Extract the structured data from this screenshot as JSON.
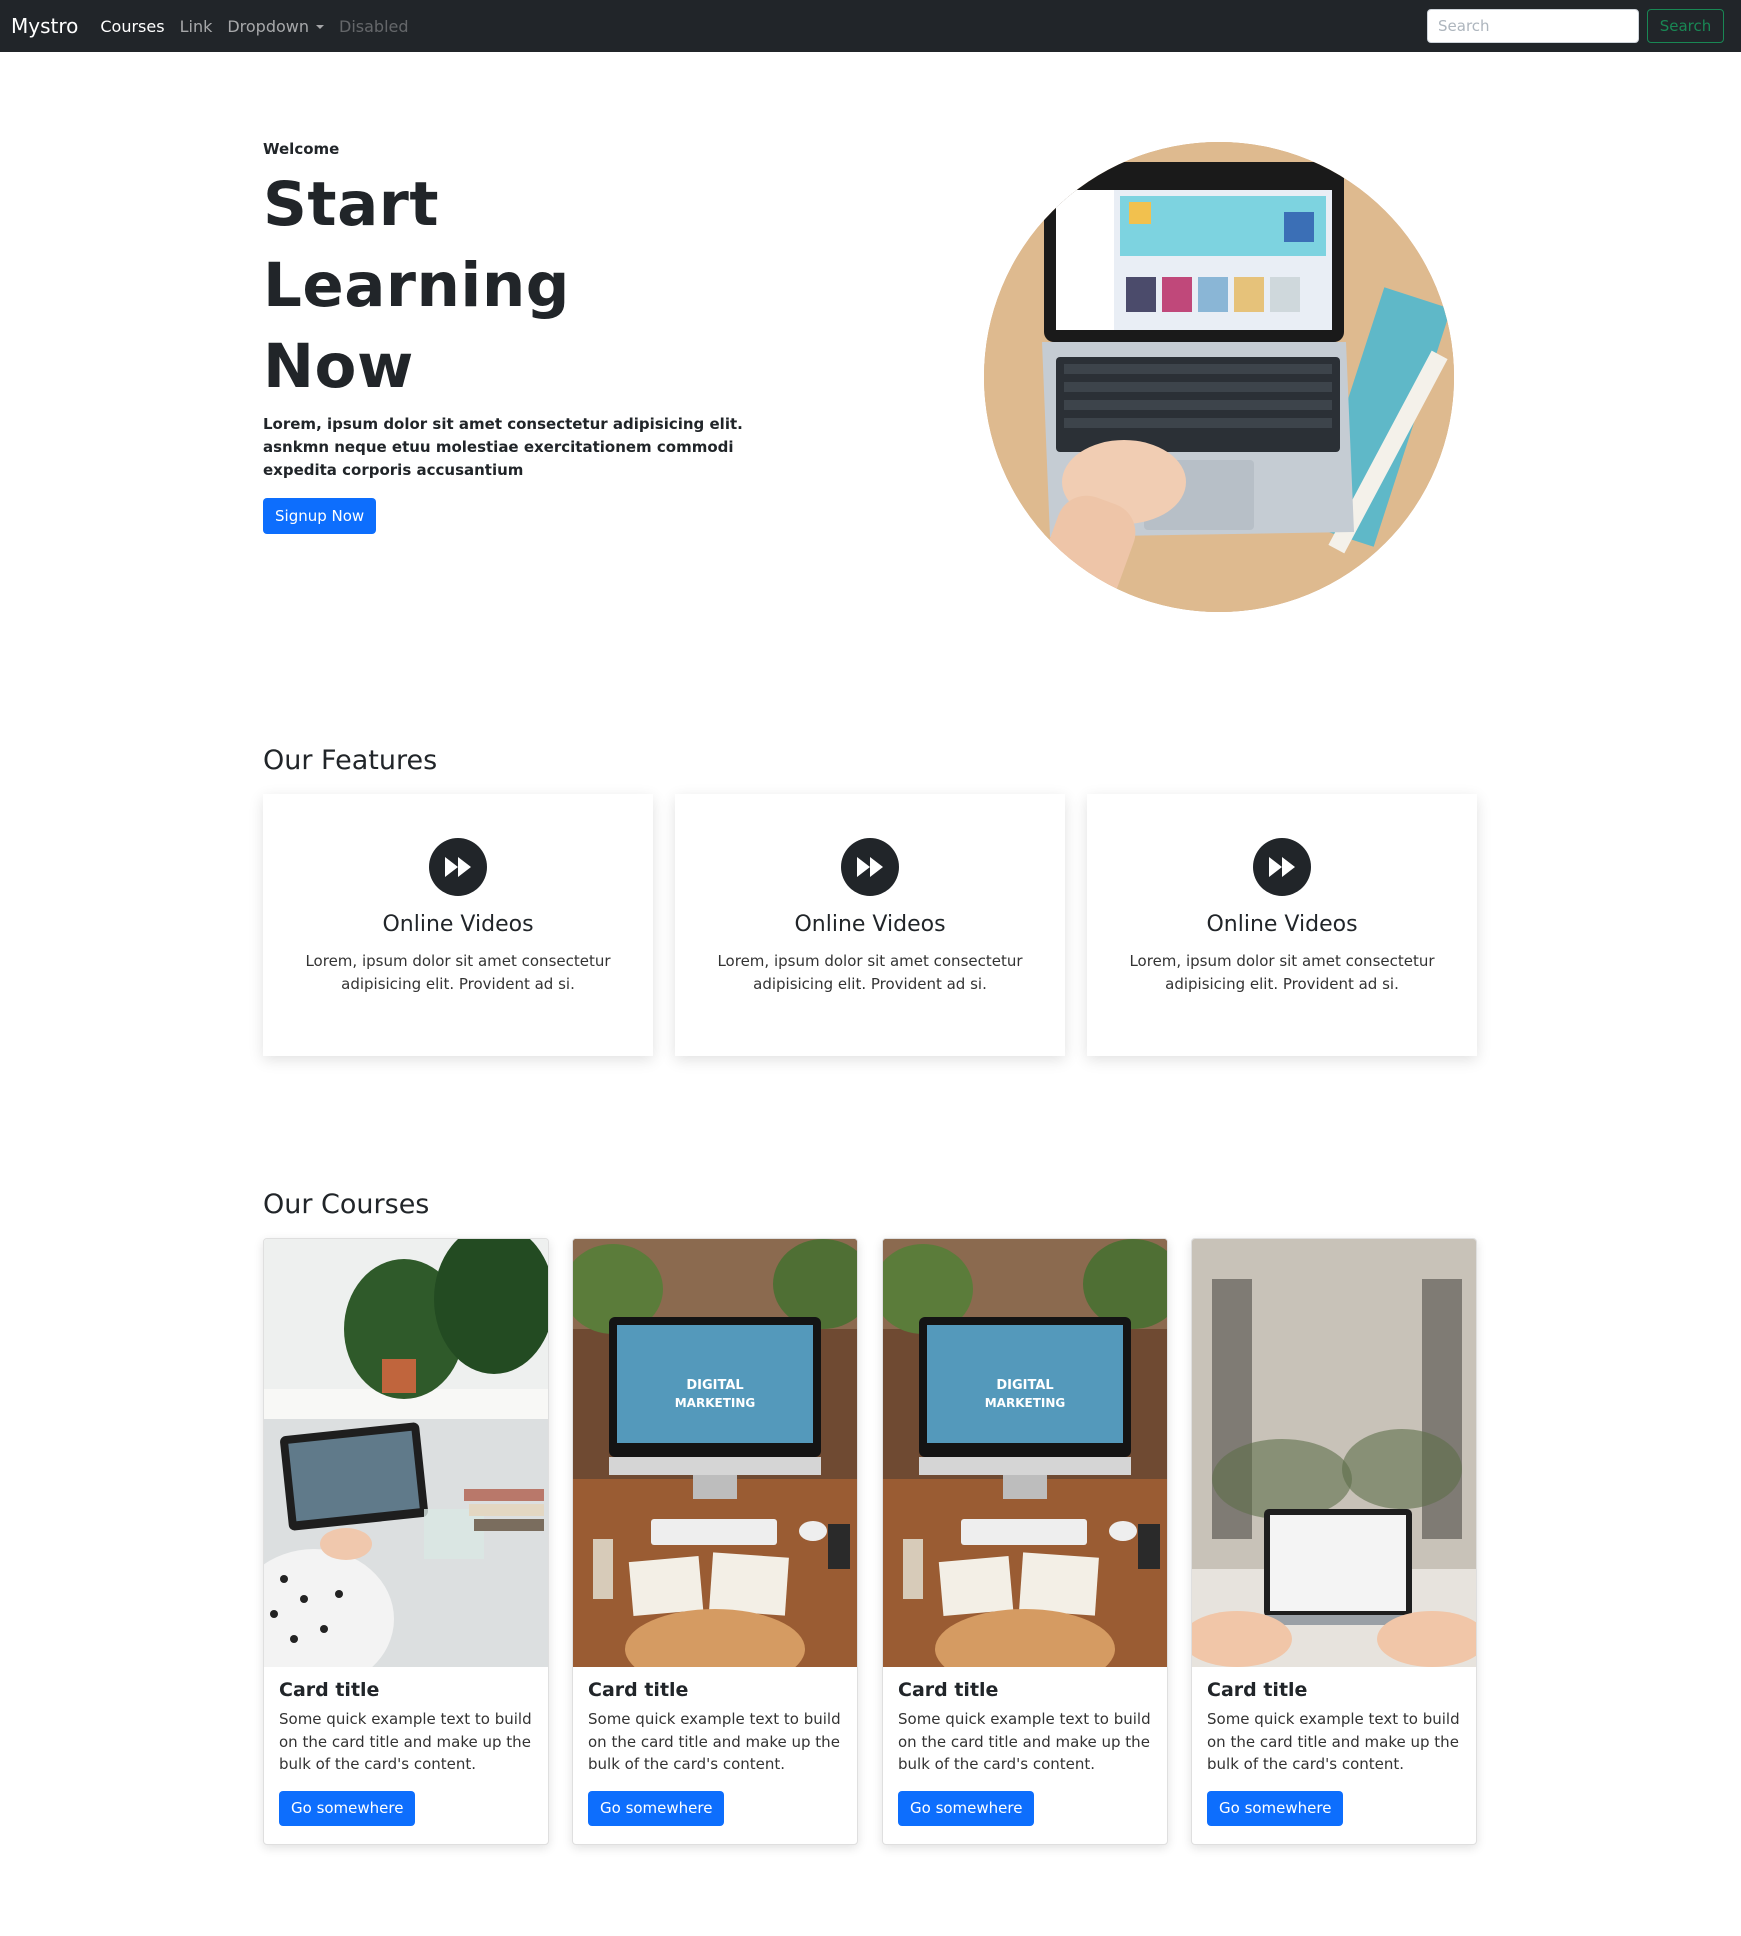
{
  "navbar": {
    "brand": "Mystro",
    "links": [
      {
        "label": "Courses",
        "state": "active"
      },
      {
        "label": "Link",
        "state": "normal"
      },
      {
        "label": "Dropdown",
        "state": "dropdown"
      },
      {
        "label": "Disabled",
        "state": "disabled"
      }
    ],
    "search_placeholder": "Search",
    "search_button": "Search"
  },
  "hero": {
    "eyebrow": "Welcome",
    "title": "Start Learning Now",
    "text": "Lorem, ipsum dolor sit amet consectetur adipisicing elit. asnkmn neque etuu molestiae exercitationem commodi expedita corporis accusantium",
    "button": "Signup Now"
  },
  "features": {
    "title": "Our Features",
    "items": [
      {
        "icon": "fast-forward-icon",
        "title": "Online Videos",
        "text": "Lorem, ipsum dolor sit amet consectetur adipisicing elit. Provident ad si."
      },
      {
        "icon": "fast-forward-icon",
        "title": "Online Videos",
        "text": "Lorem, ipsum dolor sit amet consectetur adipisicing elit. Provident ad si."
      },
      {
        "icon": "fast-forward-icon",
        "title": "Online Videos",
        "text": "Lorem, ipsum dolor sit amet consectetur adipisicing elit. Provident ad si."
      }
    ]
  },
  "courses": {
    "title": "Our Courses",
    "items": [
      {
        "title": "Card title",
        "text": "Some quick example text to build on the card title and make up the bulk of the card's content.",
        "button": "Go somewhere"
      },
      {
        "title": "Card title",
        "text": "Some quick example text to build on the card title and make up the bulk of the card's content.",
        "button": "Go somewhere",
        "image_text_1": "DIGITAL",
        "image_text_2": "MARKETING"
      },
      {
        "title": "Card title",
        "text": "Some quick example text to build on the card title and make up the bulk of the card's content.",
        "button": "Go somewhere",
        "image_text_1": "DIGITAL",
        "image_text_2": "MARKETING"
      },
      {
        "title": "Card title",
        "text": "Some quick example text to build on the card title and make up the bulk of the card's content.",
        "button": "Go somewhere"
      }
    ]
  },
  "colors": {
    "navbar_bg": "#212529",
    "primary": "#0d6efd",
    "success": "#198754",
    "text": "#212529"
  }
}
